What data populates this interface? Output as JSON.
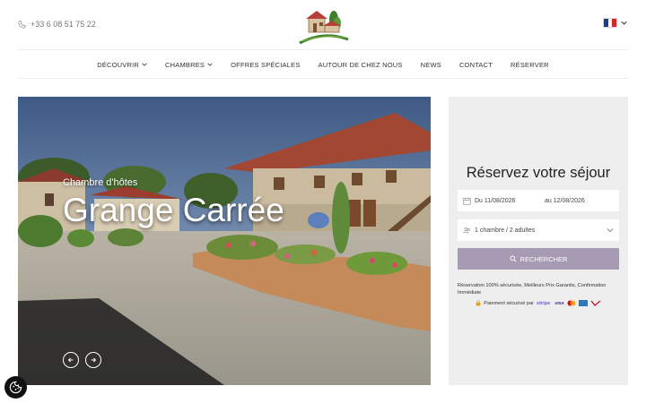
{
  "header": {
    "phone": "+33 6 08 51 75 22",
    "logo_text": "Grange Carrée",
    "language": "FR"
  },
  "nav": {
    "items": [
      {
        "label": "DÉCOUVRIR",
        "dropdown": true
      },
      {
        "label": "CHAMBRES",
        "dropdown": true
      },
      {
        "label": "OFFRES SPÉCIALES",
        "dropdown": false
      },
      {
        "label": "AUTOUR DE CHEZ NOUS",
        "dropdown": false
      },
      {
        "label": "NEWS",
        "dropdown": false
      },
      {
        "label": "CONTACT",
        "dropdown": false
      },
      {
        "label": "RÉSERVER",
        "dropdown": false
      }
    ]
  },
  "hero": {
    "subtitle": "Chambre d'hôtes",
    "title": "Grange Carrée"
  },
  "booking": {
    "title": "Réservez votre séjour",
    "date_from": "Du 11/08/2026",
    "date_to": "au 12/08/2026",
    "guests": "1 chambre / 2 adultes",
    "search_label": "RECHERCHER",
    "note": "Réservation 100% sécurisée, Meilleurs Prix Garantis, Confirmation Immédiate",
    "payment_label": "Paiement sécurisé par",
    "payment_brand": "stripe",
    "cards": [
      "VISA"
    ]
  },
  "colors": {
    "accent": "#a79bb3",
    "panel": "#eeeeee",
    "text": "#333333"
  }
}
